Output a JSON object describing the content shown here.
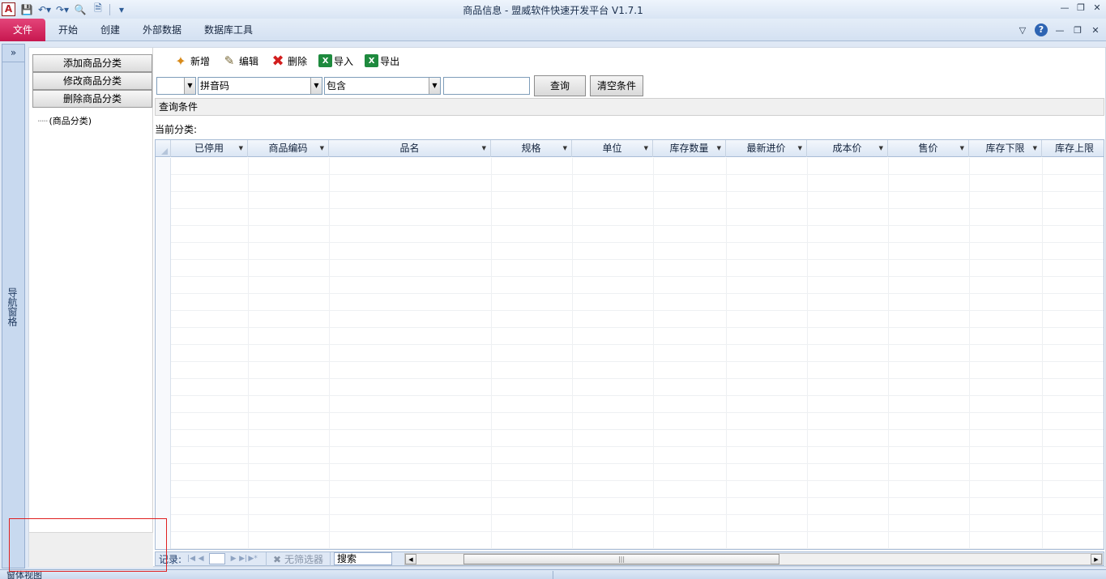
{
  "window": {
    "title": "商品信息 - 盟威软件快速开发平台 V1.7.1",
    "app_icon": "A"
  },
  "menu": {
    "file": "文件",
    "items": [
      "开始",
      "创建",
      "外部数据",
      "数据库工具"
    ]
  },
  "nav_pane": {
    "expand": "»",
    "label": "导航窗格"
  },
  "category_panel": {
    "add": "添加商品分类",
    "edit": "修改商品分类",
    "delete": "删除商品分类",
    "tree_root": "(商品分类)"
  },
  "toolbar": {
    "new": "新增",
    "edit": "编辑",
    "delete": "删除",
    "import": "导入",
    "export": "导出"
  },
  "filter": {
    "field1": "",
    "field2": "拼音码",
    "operator": "包含",
    "value": "",
    "query": "查询",
    "clear": "清空条件"
  },
  "condition_bar": "查询条件",
  "current_category": "当前分类:",
  "grid": {
    "columns": [
      "已停用",
      "商品编码",
      "品名",
      "规格",
      "单位",
      "库存数量",
      "最新进价",
      "成本价",
      "售价",
      "库存下限",
      "库存上限"
    ]
  },
  "record_nav": {
    "label": "记录:",
    "filter_state": "无筛选器",
    "search": "搜索"
  },
  "status": {
    "text": "窗体视图"
  }
}
